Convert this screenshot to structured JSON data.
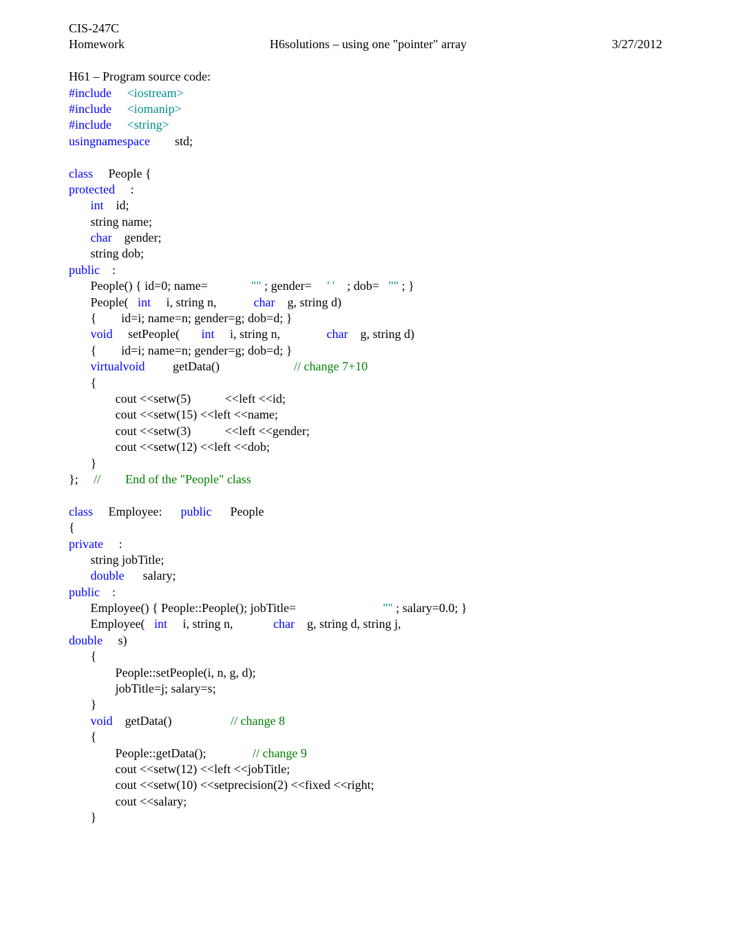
{
  "course": "CIS-247C",
  "header": {
    "left": "Homework",
    "center": "H6solutions – using one \"pointer\" array",
    "right": "3/27/2012"
  },
  "title": "H61 – Program source code:",
  "code": {
    "l1a": "#include",
    "l1b": "<iostream>",
    "l2a": "#include",
    "l2b": "<iomanip>",
    "l3a": "#include",
    "l3b": "<string>",
    "l4a": "using",
    "l4b": "namespace",
    "l4c": "        std;",
    "blank": "",
    "l5a": "class",
    "l5b": "     People {",
    "l6a": "protected",
    "l6b": "     :",
    "l7a": "       ",
    "l7b": "int",
    "l7c": "    id;",
    "l8": "       string name;",
    "l9a": "       ",
    "l9b": "char",
    "l9c": "    gender;",
    "l10": "       string dob;",
    "l11a": "public",
    "l11b": "    :",
    "l12a": "       People() { id=0; name=              ",
    "l12b": "\"\"",
    "l12c": " ; gender=     ",
    "l12d": "' '",
    "l12e": "    ; dob=   ",
    "l12f": "\"\"",
    "l12g": " ; }",
    "l13a": "       People(   ",
    "l13b": "int",
    "l13c": "     i, string n,            ",
    "l13d": "char",
    "l13e": "    g, string d)",
    "l14": "       {        id=i; name=n; gender=g; dob=d; }",
    "l15a": "       ",
    "l15b": "void",
    "l15c": "     setPeople(       ",
    "l15d": "int",
    "l15e": "     i, string n,               ",
    "l15f": "char",
    "l15g": "    g, string d)",
    "l16": "       {        id=i; name=n; gender=g; dob=d; }",
    "l17a": "       ",
    "l17b": "virtual",
    "l17c": "void",
    "l17d": "         getData()                        ",
    "l17e": "// change 7+10",
    "l18": "       {",
    "l19": "               cout <<setw(5)           <<left <<id;",
    "l20": "               cout <<setw(15) <<left <<name;",
    "l21": "               cout <<setw(3)           <<left <<gender;",
    "l22": "               cout <<setw(12) <<left <<dob;",
    "l23": "       }",
    "l24a": "};     ",
    "l24b": "//",
    "l24c": "        End of the \"People\" class",
    "l25a": "class",
    "l25b": "     Employee:      ",
    "l25c": "public",
    "l25d": "      People",
    "l26": "{",
    "l27a": "private",
    "l27b": "     :",
    "l28": "       string jobTitle;",
    "l29a": "       ",
    "l29b": "double",
    "l29c": "      salary;",
    "l30a": "public",
    "l30b": "    :",
    "l31a": "       Employee() { People::People(); jobTitle=                            ",
    "l31b": "\"\"",
    "l31c": " ; salary=0.0; }",
    "l32a": "       Employee(   ",
    "l32b": "int",
    "l32c": "     i, string n,             ",
    "l32d": "char",
    "l32e": "    g, string d, string j, ",
    "l33a": "double",
    "l33b": "     s)",
    "l34": "       {",
    "l35": "               People::setPeople(i, n, g, d);",
    "l36": "               jobTitle=j; salary=s;",
    "l37": "       }",
    "l38a": "       ",
    "l38b": "void",
    "l38c": "    getData()                   ",
    "l38d": "// change 8",
    "l39": "       {",
    "l40a": "               People::getData();               ",
    "l40b": "// change 9",
    "l41": "               cout <<setw(12) <<left <<jobTitle;",
    "l42": "               cout <<setw(10) <<setprecision(2) <<fixed <<right;",
    "l43": "               cout <<salary;",
    "l44": "       }"
  }
}
